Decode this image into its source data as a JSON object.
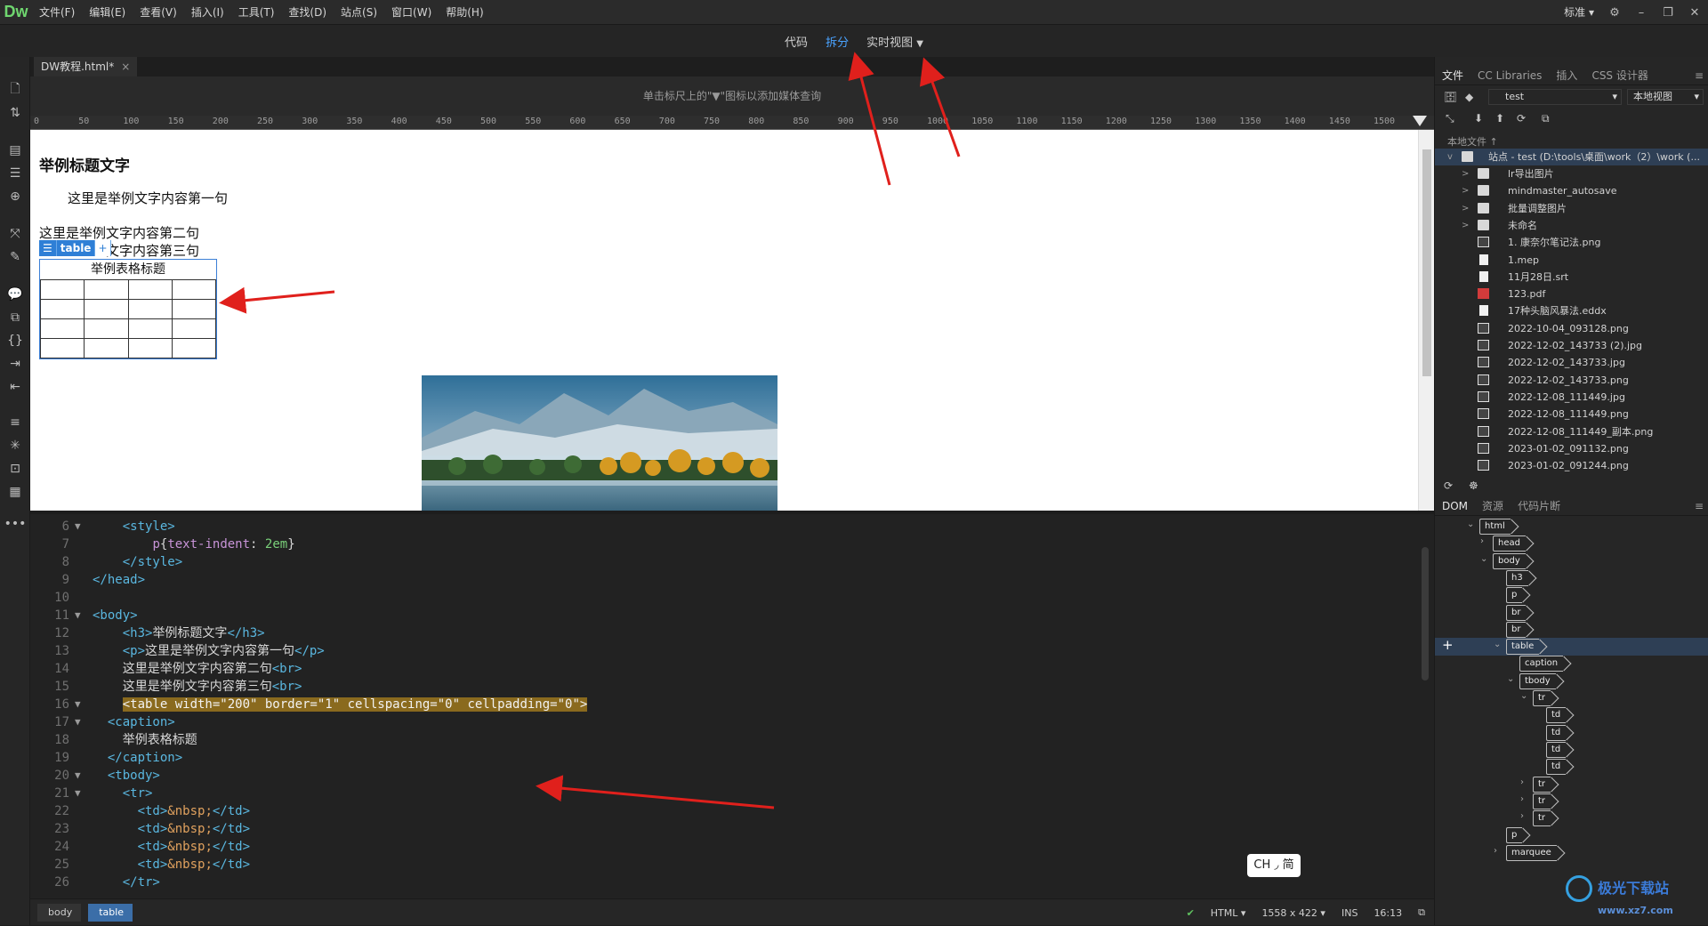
{
  "app": {
    "logo": "Dw",
    "menu": [
      "文件(F)",
      "编辑(E)",
      "查看(V)",
      "插入(I)",
      "工具(T)",
      "查找(D)",
      "站点(S)",
      "窗口(W)",
      "帮助(H)"
    ],
    "workspace": "标准"
  },
  "views": {
    "code": "代码",
    "split": "拆分",
    "live": "实时视图"
  },
  "document": {
    "tab_label": "DW教程.html*",
    "media_query_hint": "单击标尺上的\"▼\"图标以添加媒体查询",
    "ruler_ticks": [
      "0",
      "50",
      "100",
      "150",
      "200",
      "250",
      "300",
      "350",
      "400",
      "450",
      "500",
      "550",
      "600",
      "650",
      "700",
      "750",
      "800",
      "850",
      "900",
      "950",
      "1000",
      "1050",
      "1100",
      "1150",
      "1200",
      "1250",
      "1300",
      "1350",
      "1400",
      "1450",
      "1500"
    ]
  },
  "live_view": {
    "h3": "举例标题文字",
    "p": "这里是举例文字内容第一句",
    "line2": "这里是举例文字内容第二句",
    "line3": "这里是举例文字内容第三句",
    "line3_visible": "文字内容第三句",
    "table_tag_label": "table",
    "table_caption": "举例表格标题",
    "table_rows": 4,
    "table_cols": 4
  },
  "code_lines": [
    {
      "n": "6",
      "fold": true,
      "html": "    <span class=\"t\">&lt;style&gt;</span>"
    },
    {
      "n": "7",
      "fold": false,
      "html": "        <span class=\"css-s\">p</span><span class=\"s\">{</span><span class=\"css-s\">text-indent</span><span class=\"s\">: </span><span class=\"css-v\">2em</span><span class=\"s\">}</span>"
    },
    {
      "n": "8",
      "fold": false,
      "html": "    <span class=\"t\">&lt;/style&gt;</span>"
    },
    {
      "n": "9",
      "fold": false,
      "html": "<span class=\"t\">&lt;/head&gt;</span>"
    },
    {
      "n": "10",
      "fold": false,
      "html": ""
    },
    {
      "n": "11",
      "fold": true,
      "html": "<span class=\"t\">&lt;body&gt;</span>"
    },
    {
      "n": "12",
      "fold": false,
      "html": "    <span class=\"t\">&lt;h3&gt;</span><span class=\"s\">举例标题文字</span><span class=\"t\">&lt;/h3&gt;</span>"
    },
    {
      "n": "13",
      "fold": false,
      "html": "    <span class=\"t\">&lt;p&gt;</span><span class=\"s\">这里是举例文字内容第一句</span><span class=\"t\">&lt;/p&gt;</span>"
    },
    {
      "n": "14",
      "fold": false,
      "html": "    <span class=\"s\">这里是举例文字内容第二句</span><span class=\"t\">&lt;br&gt;</span>"
    },
    {
      "n": "15",
      "fold": false,
      "html": "    <span class=\"s\">这里是举例文字内容第三句</span><span class=\"t\">&lt;br&gt;</span>"
    },
    {
      "n": "16",
      "fold": true,
      "html": "    <span class=\"hl\">&lt;table width=\"200\" border=\"1\" cellspacing=\"0\" cellpadding=\"0\"&gt;</span>"
    },
    {
      "n": "17",
      "fold": true,
      "html": "  <span class=\"t\">&lt;caption&gt;</span>"
    },
    {
      "n": "18",
      "fold": false,
      "html": "    <span class=\"s\">举例表格标题</span>"
    },
    {
      "n": "19",
      "fold": false,
      "html": "  <span class=\"t\">&lt;/caption&gt;</span>"
    },
    {
      "n": "20",
      "fold": true,
      "html": "  <span class=\"t\">&lt;tbody&gt;</span>"
    },
    {
      "n": "21",
      "fold": true,
      "html": "    <span class=\"t\">&lt;tr&gt;</span>"
    },
    {
      "n": "22",
      "fold": false,
      "html": "      <span class=\"t\">&lt;td&gt;</span><span class=\"ent\">&amp;nbsp;</span><span class=\"t\">&lt;/td&gt;</span>"
    },
    {
      "n": "23",
      "fold": false,
      "html": "      <span class=\"t\">&lt;td&gt;</span><span class=\"ent\">&amp;nbsp;</span><span class=\"t\">&lt;/td&gt;</span>"
    },
    {
      "n": "24",
      "fold": false,
      "html": "      <span class=\"t\">&lt;td&gt;</span><span class=\"ent\">&amp;nbsp;</span><span class=\"t\">&lt;/td&gt;</span>"
    },
    {
      "n": "25",
      "fold": false,
      "html": "      <span class=\"t\">&lt;td&gt;</span><span class=\"ent\">&amp;nbsp;</span><span class=\"t\">&lt;/td&gt;</span>"
    },
    {
      "n": "26",
      "fold": false,
      "html": "    <span class=\"t\">&lt;/tr&gt;</span>"
    }
  ],
  "ime": "CH ◞ 简",
  "status": {
    "crumbs": [
      "body",
      "table"
    ],
    "doc_type": "HTML",
    "size": "1558 x 422",
    "mode": "INS",
    "pos": "16:13"
  },
  "files_panel": {
    "tabs": [
      "文件",
      "CC Libraries",
      "插入",
      "CSS 设计器"
    ],
    "site_select": "test",
    "view_select": "本地视图",
    "local_label": "本地文件 ↑",
    "site_root": "站点 - test (D:\\tools\\桌面\\work（2）\\work (...",
    "items": [
      {
        "name": "lr导出图片",
        "type": "folder"
      },
      {
        "name": "mindmaster_autosave",
        "type": "folder"
      },
      {
        "name": "批量调整图片",
        "type": "folder"
      },
      {
        "name": "未命名",
        "type": "folder"
      },
      {
        "name": "1. 康奈尔笔记法.png",
        "type": "image"
      },
      {
        "name": "1.mep",
        "type": "doc"
      },
      {
        "name": "11月28日.srt",
        "type": "doc"
      },
      {
        "name": "123.pdf",
        "type": "pdf"
      },
      {
        "name": "17种头脑风暴法.eddx",
        "type": "doc"
      },
      {
        "name": "2022-10-04_093128.png",
        "type": "image"
      },
      {
        "name": "2022-12-02_143733 (2).jpg",
        "type": "image"
      },
      {
        "name": "2022-12-02_143733.jpg",
        "type": "image"
      },
      {
        "name": "2022-12-02_143733.png",
        "type": "image"
      },
      {
        "name": "2022-12-08_111449.jpg",
        "type": "image"
      },
      {
        "name": "2022-12-08_111449.png",
        "type": "image"
      },
      {
        "name": "2022-12-08_111449_副本.png",
        "type": "image"
      },
      {
        "name": "2023-01-02_091132.png",
        "type": "image"
      },
      {
        "name": "2023-01-02_091244.png",
        "type": "image"
      }
    ]
  },
  "dom_panel": {
    "tabs": [
      "DOM",
      "资源",
      "代码片断"
    ],
    "nodes": [
      {
        "label": "html",
        "depth": 0,
        "chev": "v"
      },
      {
        "label": "head",
        "depth": 1,
        "chev": ">"
      },
      {
        "label": "body",
        "depth": 1,
        "chev": "v"
      },
      {
        "label": "h3",
        "depth": 2,
        "chev": ""
      },
      {
        "label": "p",
        "depth": 2,
        "chev": ""
      },
      {
        "label": "br",
        "depth": 2,
        "chev": ""
      },
      {
        "label": "br",
        "depth": 2,
        "chev": ""
      },
      {
        "label": "table",
        "depth": 2,
        "chev": "v"
      },
      {
        "label": "caption",
        "depth": 3,
        "chev": ""
      },
      {
        "label": "tbody",
        "depth": 3,
        "chev": "v"
      },
      {
        "label": "tr",
        "depth": 4,
        "chev": "v"
      },
      {
        "label": "td",
        "depth": 5,
        "chev": ""
      },
      {
        "label": "td",
        "depth": 5,
        "chev": ""
      },
      {
        "label": "td",
        "depth": 5,
        "chev": ""
      },
      {
        "label": "td",
        "depth": 5,
        "chev": ""
      },
      {
        "label": "tr",
        "depth": 4,
        "chev": ">"
      },
      {
        "label": "tr",
        "depth": 4,
        "chev": ">"
      },
      {
        "label": "tr",
        "depth": 4,
        "chev": ">"
      },
      {
        "label": "p",
        "depth": 2,
        "chev": ""
      },
      {
        "label": "marquee",
        "depth": 2,
        "chev": ">"
      }
    ],
    "selected_index": 7
  },
  "colors": {
    "accent": "#4aa3ff",
    "annotation_arrow": "#e0201c"
  }
}
